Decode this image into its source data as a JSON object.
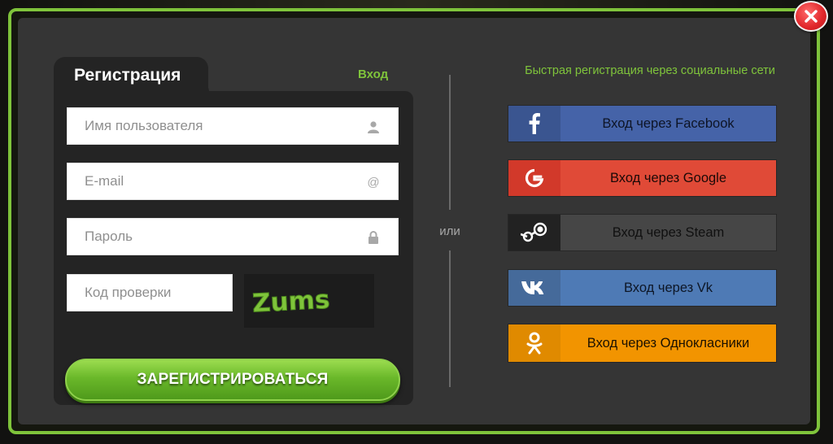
{
  "form": {
    "tab_register": "Регистрация",
    "tab_login": "Вход",
    "username_placeholder": "Имя пользователя",
    "email_placeholder": "E-mail",
    "password_placeholder": "Пароль",
    "code_placeholder": "Код проверки",
    "captcha_text": "Zums",
    "register_button": "ЗАРЕГИСТРИРОВАТЬСЯ"
  },
  "divider": {
    "text": "или"
  },
  "social": {
    "title": "Быстрая регистрация через социальные сети",
    "buttons": [
      {
        "label": "Вход через Facebook",
        "icon": "facebook-icon",
        "color": "#4563a8"
      },
      {
        "label": "Вход через Google",
        "icon": "google-icon",
        "color": "#e04a37"
      },
      {
        "label": "Вход через Steam",
        "icon": "steam-icon",
        "color": "#464646"
      },
      {
        "label": "Вход через Vk",
        "icon": "vk-icon",
        "color": "#4e7ab5"
      },
      {
        "label": "Вход через Однокласники",
        "icon": "odnoklassniki-icon",
        "color": "#f29400"
      }
    ]
  },
  "colors": {
    "accent": "#7fc43b",
    "panel": "#353535",
    "close": "#e0262a"
  }
}
